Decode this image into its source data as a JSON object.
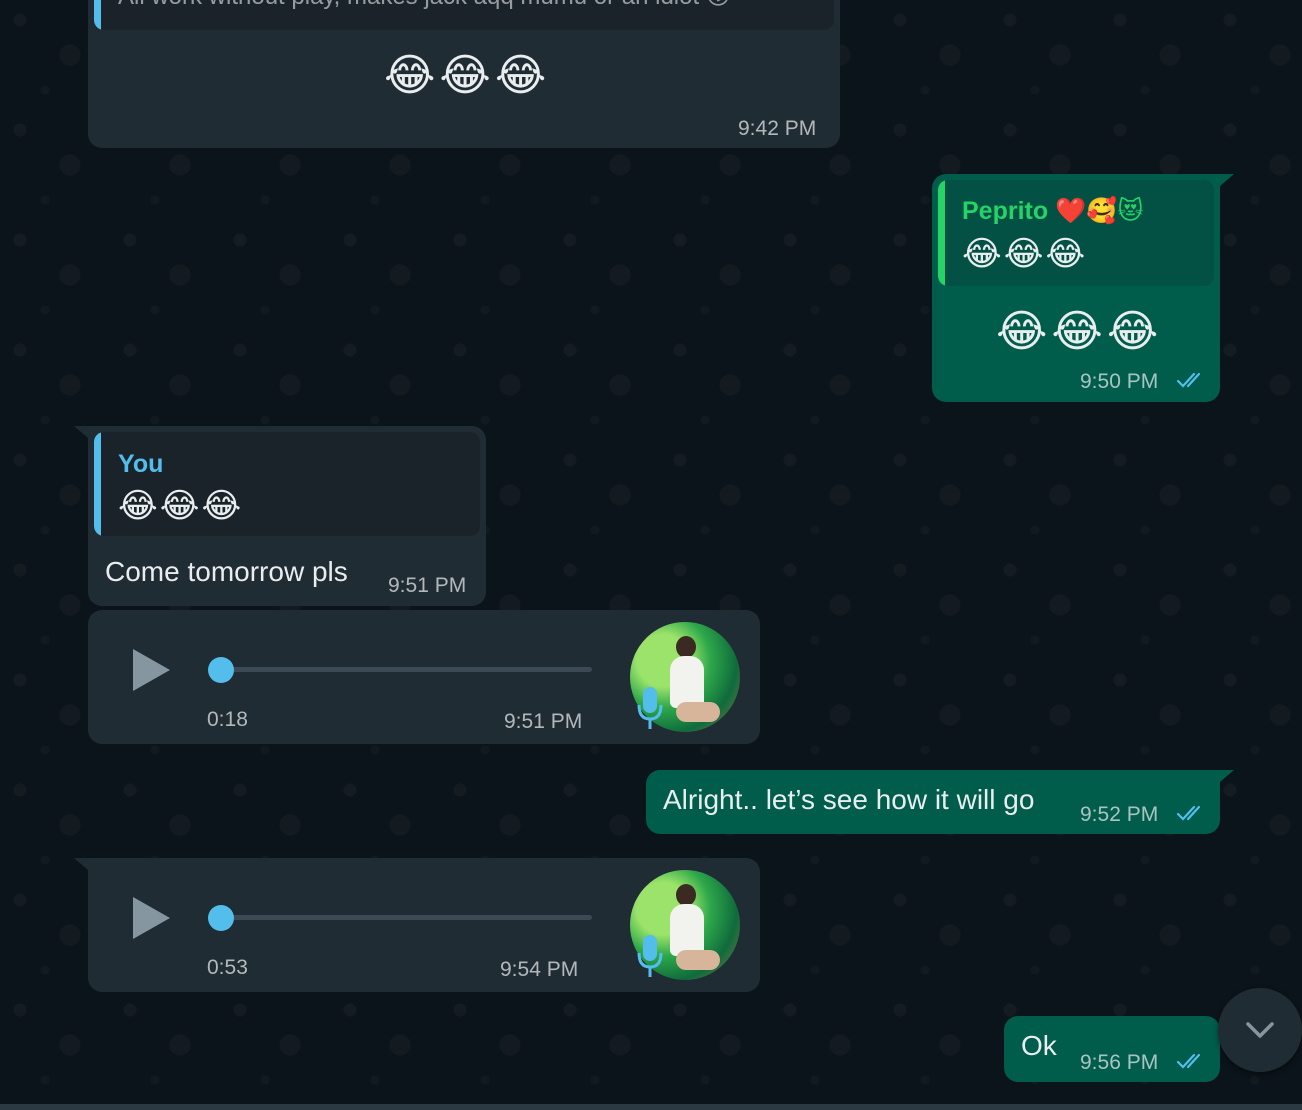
{
  "colors": {
    "background": "#0b141a",
    "incoming_bubble": "#202c33",
    "outgoing_bubble": "#005c4b",
    "read_ticks": "#53bdeb",
    "quote_author_incoming": "#53bdeb",
    "quote_author_outgoing": "#25d366"
  },
  "messages": {
    "m1": {
      "quoted_text": "All work without play, makes jack aqq mumu or an idiot 😗",
      "emojis": "😂😂😂",
      "time": "9:42 PM"
    },
    "m2": {
      "quote_author": "Peprito ❤️🥰😻",
      "quote_text": "😂😂😂",
      "emojis": "😂😂😂",
      "time": "9:50 PM",
      "status": "read"
    },
    "m3": {
      "quote_author": "You",
      "quote_text": "😂😂😂",
      "text": "Come tomorrow pls",
      "time": "9:51 PM"
    },
    "m4": {
      "type": "voice",
      "duration": "0:18",
      "time": "9:51 PM",
      "progress": 0
    },
    "m5": {
      "text": "Alright.. let’s see how it will go",
      "time": "9:52 PM",
      "status": "read"
    },
    "m6": {
      "type": "voice",
      "duration": "0:53",
      "time": "9:54 PM",
      "progress": 0
    },
    "m7": {
      "text": "Ok",
      "time": "9:56 PM",
      "status": "read"
    }
  },
  "icons": {
    "play": "play-icon",
    "mic": "mic-icon",
    "ticks": "double-check-icon",
    "scroll": "chevron-down-icon"
  }
}
